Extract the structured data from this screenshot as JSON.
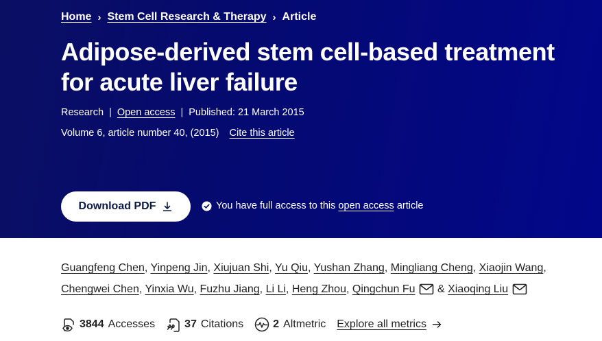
{
  "breadcrumb": {
    "home": "Home",
    "journal": "Stem Cell Research & Therapy",
    "current": "Article",
    "separator": "›"
  },
  "article": {
    "title_line1": "Adipose-derived stem cell-based treatment",
    "title_line2": "for acute liver failure",
    "type": "Research",
    "access": "Open access",
    "published": "Published: 21 March 2015",
    "volume": "Volume 6, article number 40, (2015)",
    "cite": "Cite this article"
  },
  "actions": {
    "download_pdf": "Download PDF",
    "access_prefix": "You have full access to this",
    "access_link": "open access",
    "access_suffix": "article"
  },
  "authors": [
    "Guangfeng Chen",
    "Yinpeng Jin",
    "Xiujuan Shi",
    "Yu Qiu",
    "Yushan Zhang",
    "Mingliang Cheng",
    "Xiaojin Wang",
    "Chengwei Chen",
    "Yinxia Wu",
    "Fuzhu Jiang",
    "Li Li",
    "Heng Zhou",
    "Qingchun Fu",
    "Xiaoqing Liu"
  ],
  "authors_and": "&",
  "metrics": {
    "accesses_count": "3844",
    "accesses_label": "Accesses",
    "citations_count": "37",
    "citations_label": "Citations",
    "altmetric_count": "2",
    "altmetric_label": "Altmetric",
    "explore": "Explore all metrics"
  },
  "icons": {
    "breadcrumb_sep": "chevron-right-icon",
    "download": "download-icon",
    "access": "check-circle-icon",
    "mail": "mail-icon",
    "accesses": "eye-document-icon",
    "citations": "quote-document-icon",
    "altmetric": "altmetric-icon",
    "explore": "arrow-right-icon"
  },
  "colors": {
    "hero_bg": "#050a6e",
    "text_dark": "#222222",
    "button_text": "#0b1b45"
  }
}
